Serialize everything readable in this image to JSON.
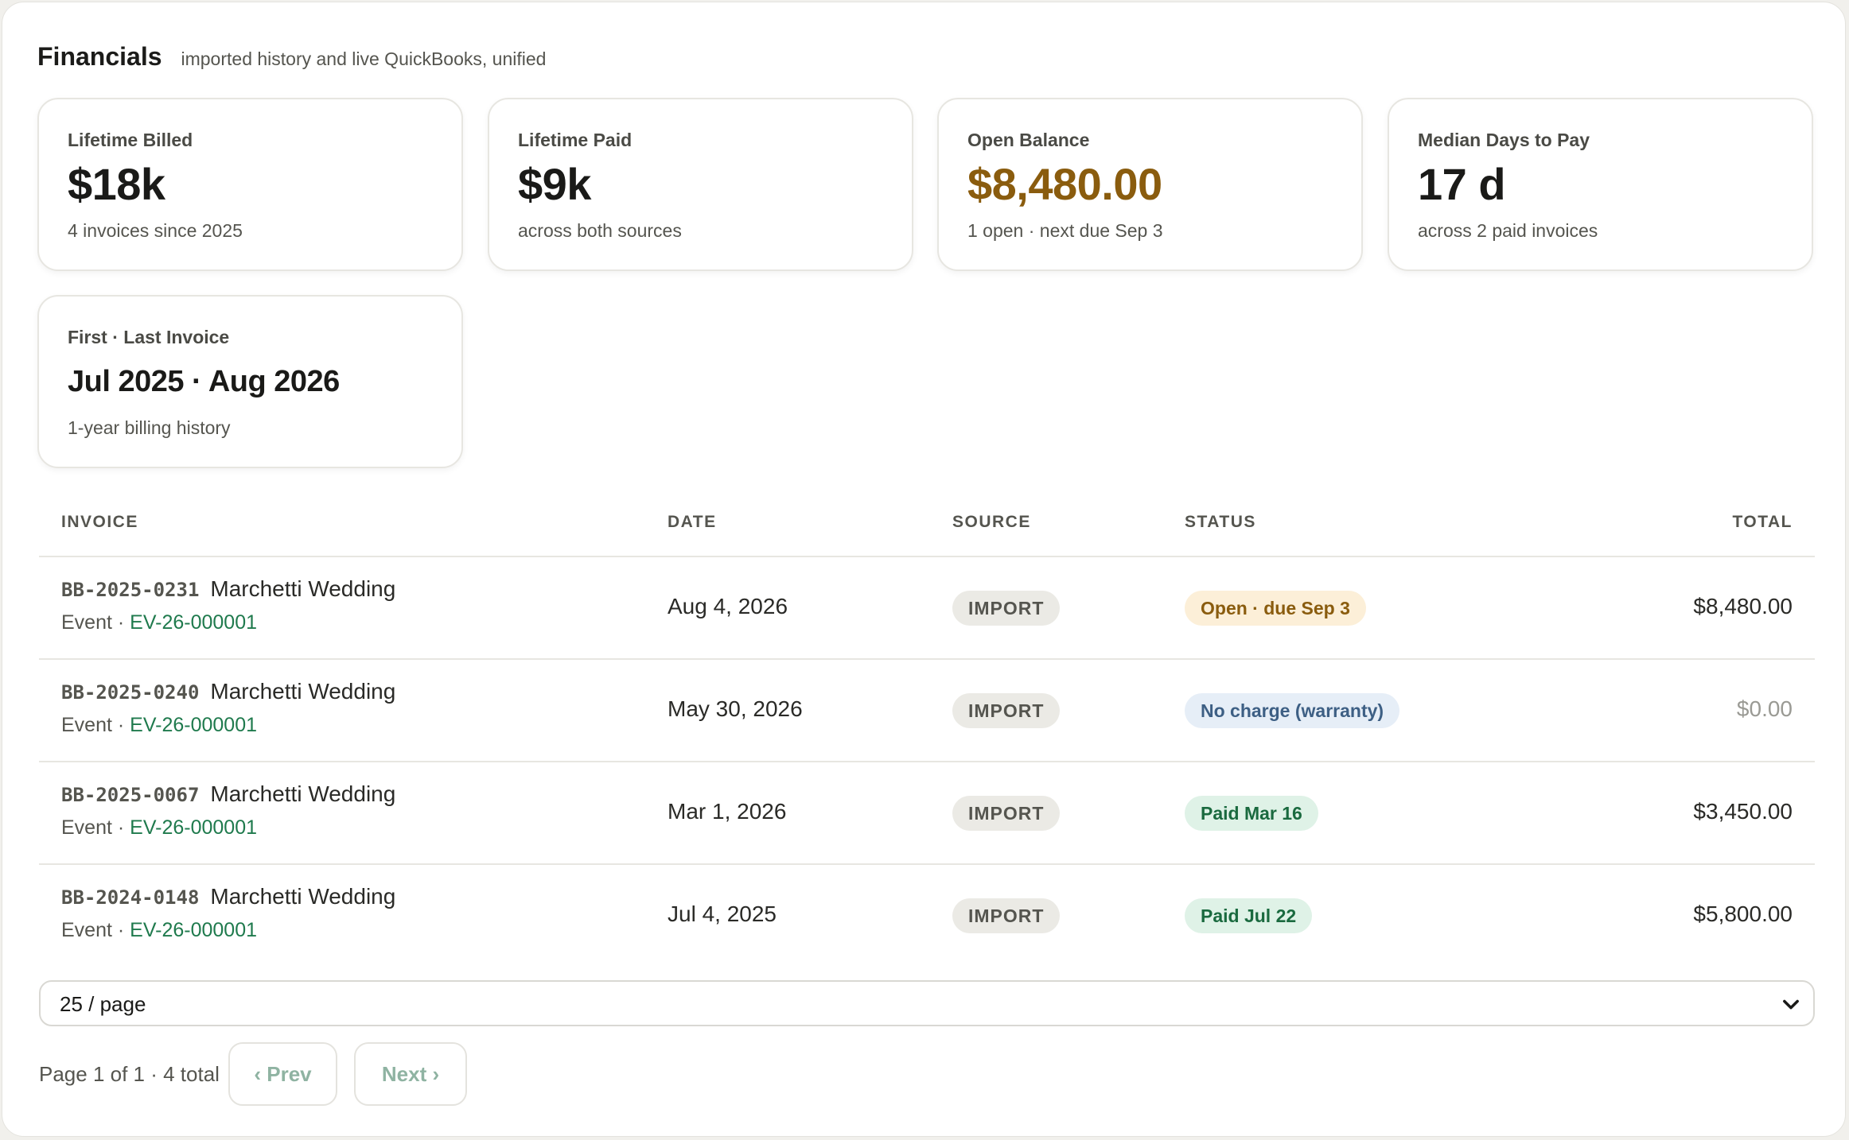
{
  "header": {
    "title": "Financials",
    "subtitle": "imported history and live QuickBooks, unified"
  },
  "cards": [
    {
      "label": "Lifetime Billed",
      "value": "$18k",
      "note": "4 invoices since 2025"
    },
    {
      "label": "Lifetime Paid",
      "value": "$9k",
      "note": "across both sources"
    },
    {
      "label": "Open Balance",
      "value": "$8,480.00",
      "note": "1 open · next due Sep 3"
    },
    {
      "label": "Median Days to Pay",
      "value": "17 d",
      "note": "across 2 paid invoices"
    },
    {
      "label": "First · Last Invoice",
      "value": "Jul 2025 · Aug 2026",
      "note": "1-year billing history"
    }
  ],
  "colors": {
    "accent_amber": "#8a5c0e",
    "link_green": "#1f7a4d",
    "paid_green": "#1a6a3f",
    "warranty_blue": "#3d5f84"
  },
  "table": {
    "headers": {
      "invoice": "INVOICE",
      "date": "DATE",
      "source": "SOURCE",
      "status": "STATUS",
      "total": "TOTAL"
    },
    "rows": [
      {
        "id": "BB-2025-0231",
        "name": "Marchetti Wedding",
        "type": "Event · ",
        "event": "EV-26-000001",
        "date": "Aug 4, 2026",
        "source": "IMPORT",
        "status": "Open · due Sep 3",
        "total": "$8,480.00"
      },
      {
        "id": "BB-2025-0240",
        "name": "Marchetti Wedding",
        "type": "Event · ",
        "event": "EV-26-000001",
        "date": "May 30, 2026",
        "source": "IMPORT",
        "status": "No charge (warranty)",
        "total": "$0.00"
      },
      {
        "id": "BB-2025-0067",
        "name": "Marchetti Wedding",
        "type": "Event · ",
        "event": "EV-26-000001",
        "date": "Mar 1, 2026",
        "source": "IMPORT",
        "status": "Paid Mar 16",
        "total": "$3,450.00"
      },
      {
        "id": "BB-2024-0148",
        "name": "Marchetti Wedding",
        "type": "Event · ",
        "event": "EV-26-000001",
        "date": "Jul 4, 2025",
        "source": "IMPORT",
        "status": "Paid Jul 22",
        "total": "$5,800.00"
      }
    ]
  },
  "pagination": {
    "page_size": "25 / page",
    "summary": "Page 1 of 1 · 4 total",
    "prev": "‹ Prev",
    "next": "Next ›"
  }
}
